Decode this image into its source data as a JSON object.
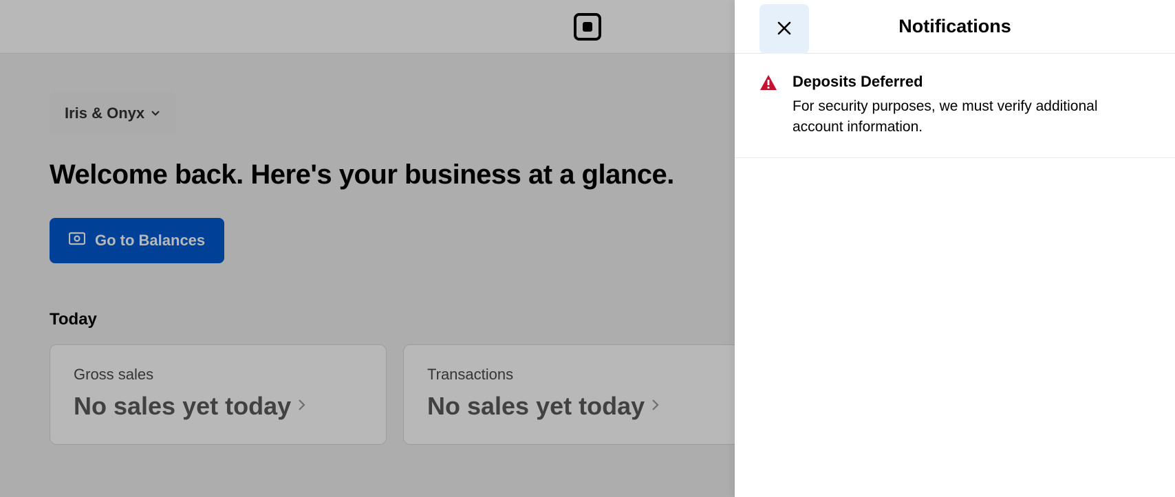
{
  "business": {
    "name": "Iris & Onyx"
  },
  "headline": "Welcome back. Here's your business at a glance.",
  "primary_action": {
    "label": "Go to Balances"
  },
  "today": {
    "section_title": "Today",
    "cards": [
      {
        "label": "Gross sales",
        "value": "No sales yet today"
      },
      {
        "label": "Transactions",
        "value": "No sales yet today"
      }
    ]
  },
  "notifications": {
    "panel_title": "Notifications",
    "items": [
      {
        "severity": "warning",
        "title": "Deposits Deferred",
        "body": "For security purposes, we must verify additional account information."
      }
    ]
  },
  "colors": {
    "primary": "#005bd3",
    "alert": "#c41230"
  }
}
